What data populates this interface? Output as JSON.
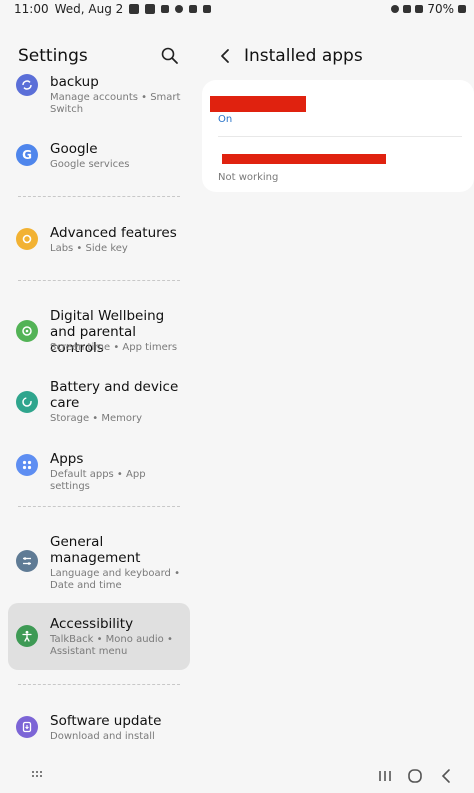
{
  "status_bar": {
    "time": "11:00",
    "date": "Wed, Aug 2",
    "battery": "70%"
  },
  "settings": {
    "title": "Settings",
    "items": [
      {
        "title": "backup",
        "subtitle": "Manage accounts • Smart Switch",
        "icon": "sync-icon",
        "color": "#5b6fd8"
      },
      {
        "title": "Google",
        "subtitle": "Google services",
        "icon": "google-icon",
        "color": "#4f86ec"
      },
      {
        "title": "Advanced features",
        "subtitle": "Labs • Side key",
        "icon": "gear-plus-icon",
        "color": "#f2b233"
      },
      {
        "title": "Digital Wellbeing and parental controls",
        "subtitle": "Screen time • App timers",
        "icon": "heart-icon",
        "color": "#53b356"
      },
      {
        "title": "Battery and device care",
        "subtitle": "Storage • Memory",
        "icon": "refresh-icon",
        "color": "#2fa58d"
      },
      {
        "title": "Apps",
        "subtitle": "Default apps • App settings",
        "icon": "grid-icon",
        "color": "#5e8ef2"
      },
      {
        "title": "General management",
        "subtitle": "Language and keyboard • Date and time",
        "icon": "sliders-icon",
        "color": "#5f7b95"
      },
      {
        "title": "Accessibility",
        "subtitle": "TalkBack • Mono audio • Assistant menu",
        "icon": "person-icon",
        "color": "#3e9a55"
      },
      {
        "title": "Software update",
        "subtitle": "Download and install",
        "icon": "update-icon",
        "color": "#7c65d6"
      }
    ]
  },
  "installed_apps": {
    "title": "Installed apps",
    "apps": [
      {
        "status": "On",
        "status_color": "#2a74c9"
      },
      {
        "status": "Not working",
        "status_color": "#7a7a7a"
      }
    ]
  },
  "colors": {
    "redaction": "#e0220f",
    "active_item_bg": "#e0e0e0"
  }
}
